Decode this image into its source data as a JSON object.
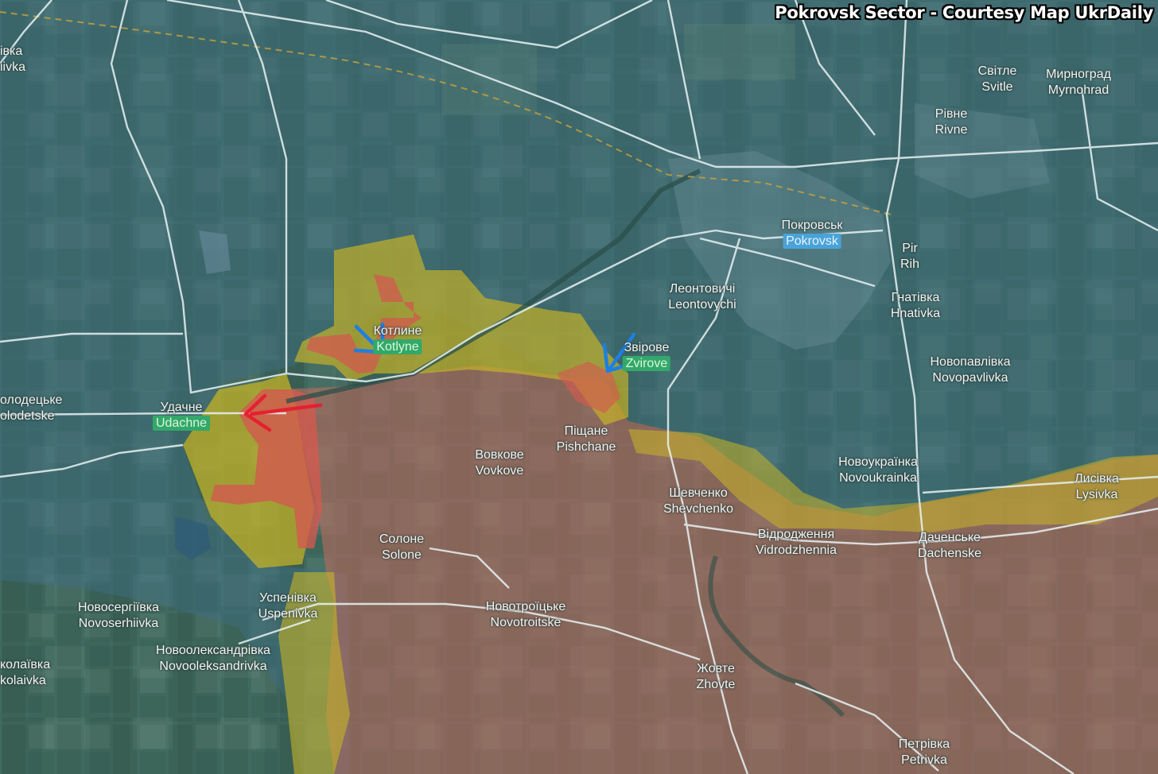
{
  "title": "Pokrovsk Sector - Courtesy Map UkrDaily",
  "colors": {
    "ukraine_controlled": "#3f6f82",
    "russia_controlled": "#b86b5e",
    "contested": "#c8b426",
    "russian_gain": "#d0574f",
    "advance_arrow_red": "#e42131",
    "advance_arrow_blue": "#1e7fe0",
    "road": "#e8f2f4",
    "railway_marker": "#c9a23a"
  },
  "places": [
    {
      "cyr": "Світле",
      "lat": "Svitle"
    },
    {
      "cyr": "Мирноград",
      "lat": "Myrnohrad"
    },
    {
      "cyr": "Рівне",
      "lat": "Rivne"
    },
    {
      "cyr": "Покровськ",
      "lat": "Pokrovsk"
    },
    {
      "cyr": "Pir",
      "lat": "Rih"
    },
    {
      "cyr": "Леонтовичі",
      "lat": "Leontovychi"
    },
    {
      "cyr": "Гнатівка",
      "lat": "Hnativka"
    },
    {
      "cyr": "Котлине",
      "lat": "Kotlyne"
    },
    {
      "cyr": "Звірове",
      "lat": "Zvirove"
    },
    {
      "cyr": "Новопавлівка",
      "lat": "Novopavlivka"
    },
    {
      "cyr": "Удачне",
      "lat": "Udachne"
    },
    {
      "cyr": "Піщане",
      "lat": "Pishchane"
    },
    {
      "cyr": "Вовкове",
      "lat": "Vovkove"
    },
    {
      "cyr": "Новоукраїнка",
      "lat": "Novoukrainka"
    },
    {
      "cyr": "Лисівка",
      "lat": "Lysivka"
    },
    {
      "cyr": "Шевченко",
      "lat": "Shevchenko"
    },
    {
      "cyr": "Відродження",
      "lat": "Vidrodzhennia"
    },
    {
      "cyr": "Даченське",
      "lat": "Dachenske"
    },
    {
      "cyr": "Солоне",
      "lat": "Solone"
    },
    {
      "cyr": "Успенівка",
      "lat": "Uspenivka"
    },
    {
      "cyr": "Новотроїцьке",
      "lat": "Novotroitske"
    },
    {
      "cyr": "Новосергіївка",
      "lat": "Novoserhiivka"
    },
    {
      "cyr": "Новоолександрівка",
      "lat": "Novooleksandrivka"
    },
    {
      "cyr": "Жовте",
      "lat": "Zhovte"
    },
    {
      "cyr": "Петрівка",
      "lat": "Petrivka"
    },
    {
      "cyr": "олодецьке",
      "lat": "olodetske"
    },
    {
      "cyr": "колаївка",
      "lat": "kolaivka"
    },
    {
      "cyr": "івка",
      "lat": "iivka"
    }
  ]
}
